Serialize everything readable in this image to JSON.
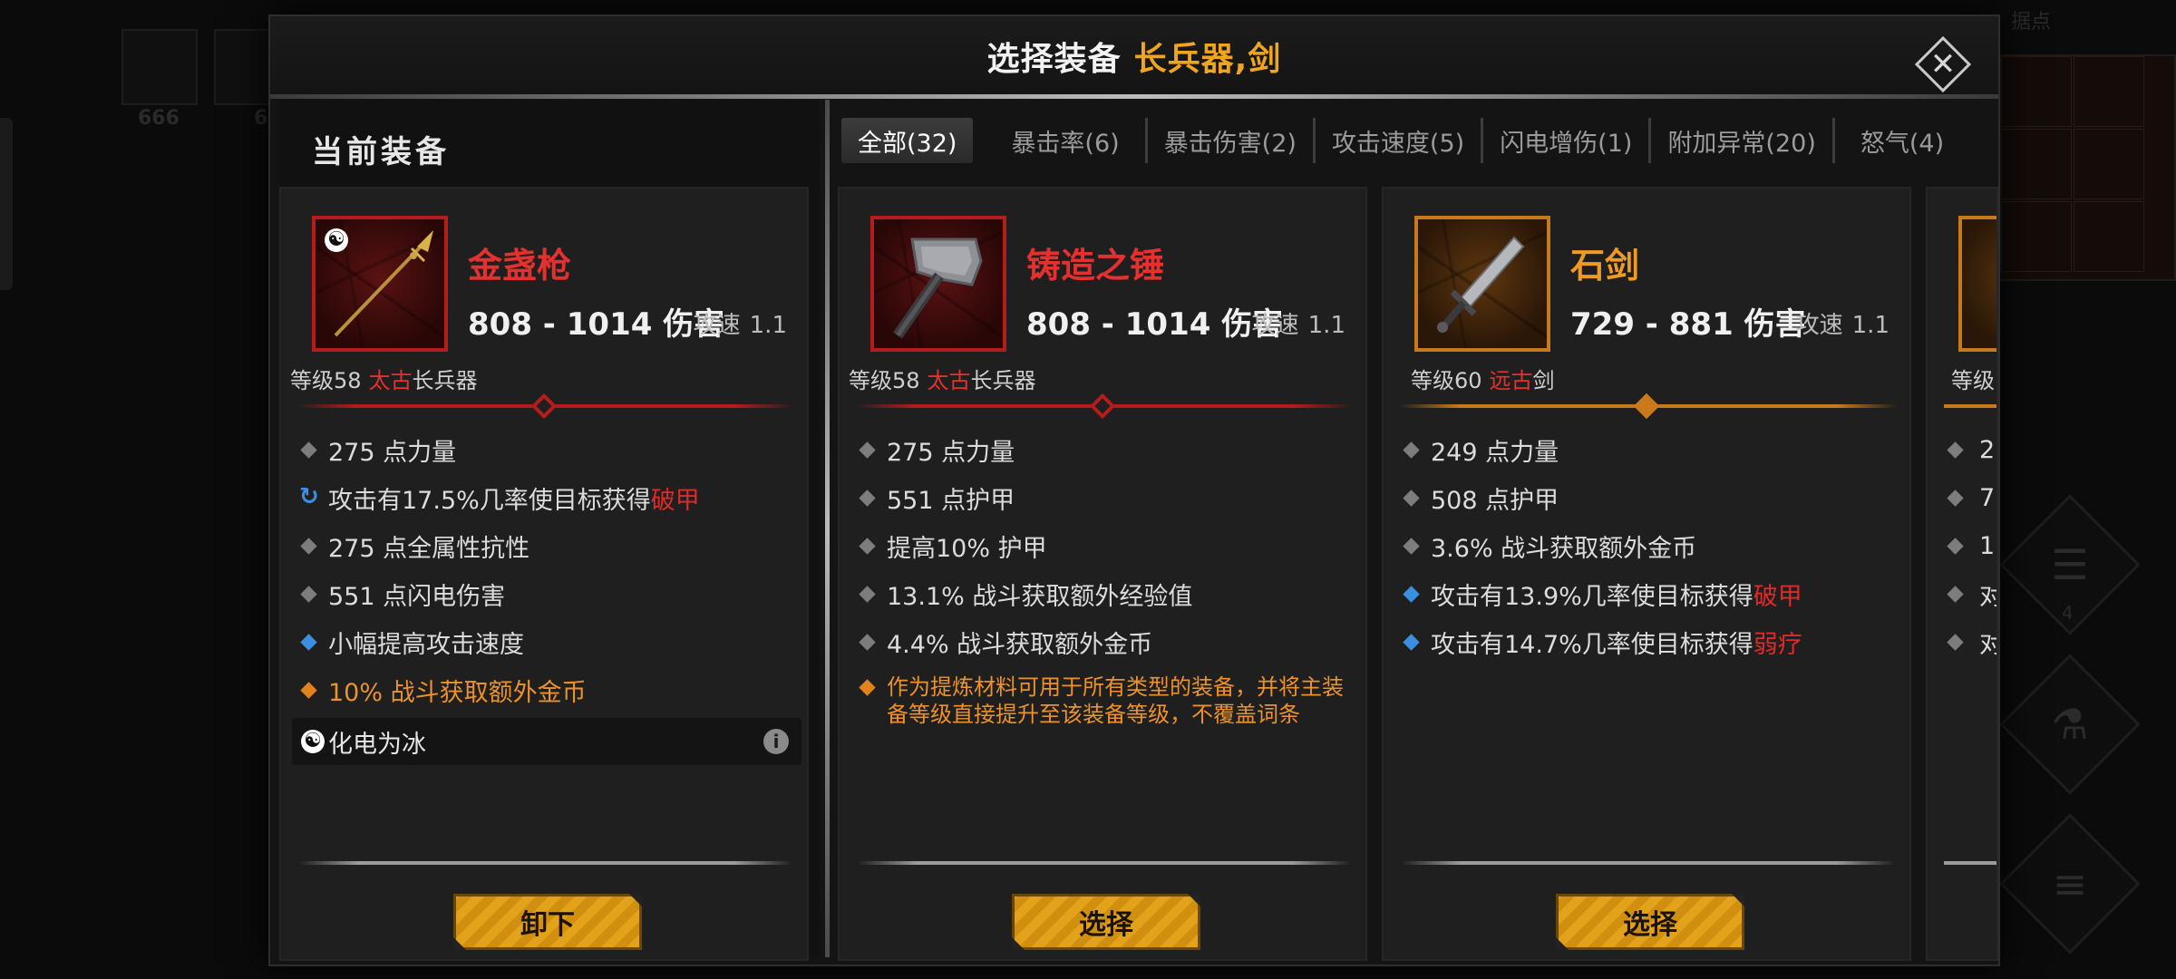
{
  "background": {
    "slot_counts": [
      "666",
      "6"
    ],
    "label_top_right": "据点",
    "badge_count": "4"
  },
  "dialog": {
    "title": "选择装备",
    "title_filter": "长兵器,剑",
    "close_icon": "close-icon"
  },
  "current": {
    "section_title": "当前装备",
    "item": {
      "name": "金盏枪",
      "damage": "808 - 1014 伤害",
      "speed_label": "攻速",
      "speed_value": "1.1",
      "level": "等级58",
      "quality": "太古",
      "kind": "长兵器",
      "stats": [
        "275 点力量",
        "攻击有17.5%几率使目标获得",
        "275 点全属性抗性",
        "551 点闪电伤害",
        "小幅提高攻击速度",
        "10% 战斗获取额外金币"
      ],
      "stat2_highlight": "破甲",
      "skill": "化电为冰",
      "button": "卸下"
    }
  },
  "tabs": [
    "全部(32)",
    "暴击率(6)",
    "暴击伤害(2)",
    "攻击速度(5)",
    "闪电增伤(1)",
    "附加异常(20)",
    "怒气(4)"
  ],
  "cards": [
    {
      "name": "铸造之锤",
      "damage": "808 - 1014 伤害",
      "speed_label": "攻速",
      "speed_value": "1.1",
      "level": "等级58",
      "quality": "太古",
      "kind": "长兵器",
      "stats": [
        "275 点力量",
        "551 点护甲",
        "提高10% 护甲",
        "13.1% 战斗获取额外经验值",
        "4.4% 战斗获取额外金币"
      ],
      "special": "作为提炼材料可用于所有类型的装备，并将主装备等级直接提升至该装备等级，不覆盖词条",
      "button": "选择"
    },
    {
      "name": "石剑",
      "damage": "729 - 881 伤害",
      "speed_label": "攻速",
      "speed_value": "1.1",
      "level": "等级60",
      "quality": "远古",
      "kind": "剑",
      "stats": [
        "249 点力量",
        "508 点护甲",
        "3.6% 战斗获取额外金币",
        "攻击有13.9%几率使目标获得",
        "攻击有14.7%几率使目标获得"
      ],
      "stat4_highlight": "破甲",
      "stat5_highlight": "弱疗",
      "button": "选择"
    }
  ],
  "partial_card": {
    "level": "等级",
    "stats": [
      "2",
      "7",
      "1",
      "对",
      "对"
    ]
  },
  "colors": {
    "red_quality": "#b51c1c",
    "orange_quality": "#c7791c",
    "accent_gold": "#f0a51f",
    "highlight_red": "#e02a2a"
  }
}
